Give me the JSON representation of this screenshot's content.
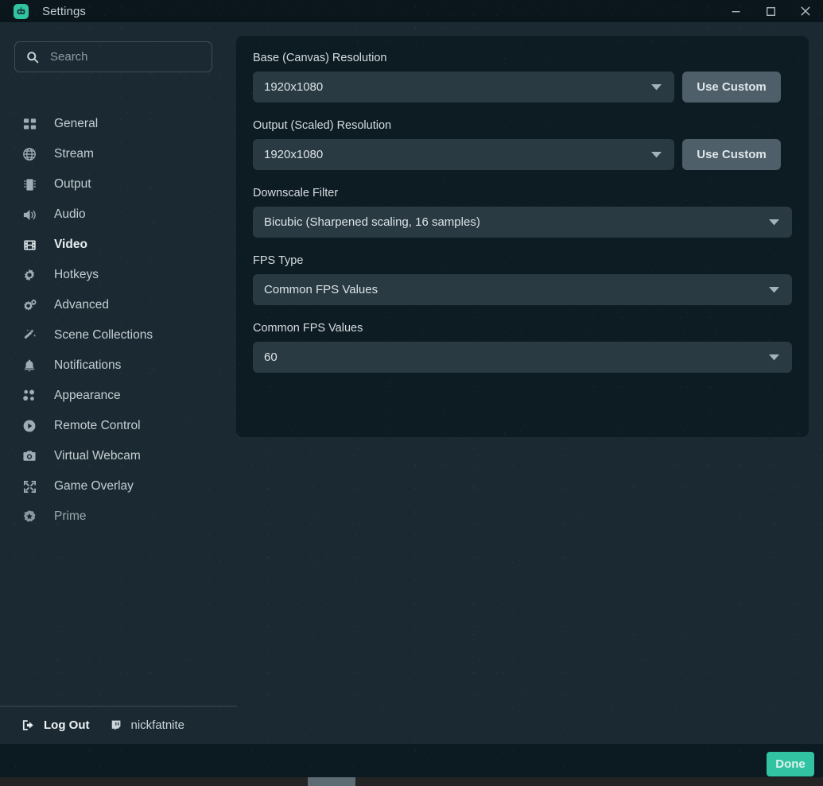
{
  "window": {
    "title": "Settings",
    "app_icon": "obs-robot-icon",
    "controls": {
      "minimize": "minimize-icon",
      "maximize": "maximize-icon",
      "close": "close-icon"
    }
  },
  "search": {
    "placeholder": "Search",
    "value": "",
    "icon": "search-icon"
  },
  "sidebar": {
    "items": [
      {
        "label": "General",
        "icon": "grid-icon",
        "active": false
      },
      {
        "label": "Stream",
        "icon": "globe-icon",
        "active": false
      },
      {
        "label": "Output",
        "icon": "chip-icon",
        "active": false
      },
      {
        "label": "Audio",
        "icon": "speaker-icon",
        "active": false
      },
      {
        "label": "Video",
        "icon": "film-icon",
        "active": true
      },
      {
        "label": "Hotkeys",
        "icon": "gear-icon",
        "active": false
      },
      {
        "label": "Advanced",
        "icon": "gears-icon",
        "active": false
      },
      {
        "label": "Scene Collections",
        "icon": "wand-icon",
        "active": false
      },
      {
        "label": "Notifications",
        "icon": "bell-icon",
        "active": false
      },
      {
        "label": "Appearance",
        "icon": "palette-icon",
        "active": false
      },
      {
        "label": "Remote Control",
        "icon": "play-circle-icon",
        "active": false
      },
      {
        "label": "Virtual Webcam",
        "icon": "camera-icon",
        "active": false
      },
      {
        "label": "Game Overlay",
        "icon": "expand-icon",
        "active": false
      },
      {
        "label": "Prime",
        "icon": "prime-star-icon",
        "active": false
      }
    ],
    "footer": {
      "logout_label": "Log Out",
      "logout_icon": "logout-icon",
      "account_name": "nickfatnite",
      "account_icon": "twitch-icon"
    }
  },
  "panel": {
    "fields": [
      {
        "label": "Base (Canvas) Resolution",
        "value": "1920x1080",
        "has_custom_button": true,
        "custom_button_label": "Use Custom"
      },
      {
        "label": "Output (Scaled) Resolution",
        "value": "1920x1080",
        "has_custom_button": true,
        "custom_button_label": "Use Custom"
      },
      {
        "label": "Downscale Filter",
        "value": "Bicubic (Sharpened scaling, 16 samples)",
        "has_custom_button": false,
        "custom_button_label": ""
      },
      {
        "label": "FPS Type",
        "value": "Common FPS Values",
        "has_custom_button": false,
        "custom_button_label": ""
      },
      {
        "label": "Common FPS Values",
        "value": "60",
        "has_custom_button": false,
        "custom_button_label": ""
      }
    ]
  },
  "action_bar": {
    "done_label": "Done"
  },
  "colors": {
    "accent": "#31c3a2",
    "titlebar_bg": "#0a161c",
    "sidebar_bg": "#1b2a32",
    "panel_bg": "#0d1b22",
    "select_bg": "#2a3a42",
    "custom_button_bg": "#4e5f69"
  }
}
